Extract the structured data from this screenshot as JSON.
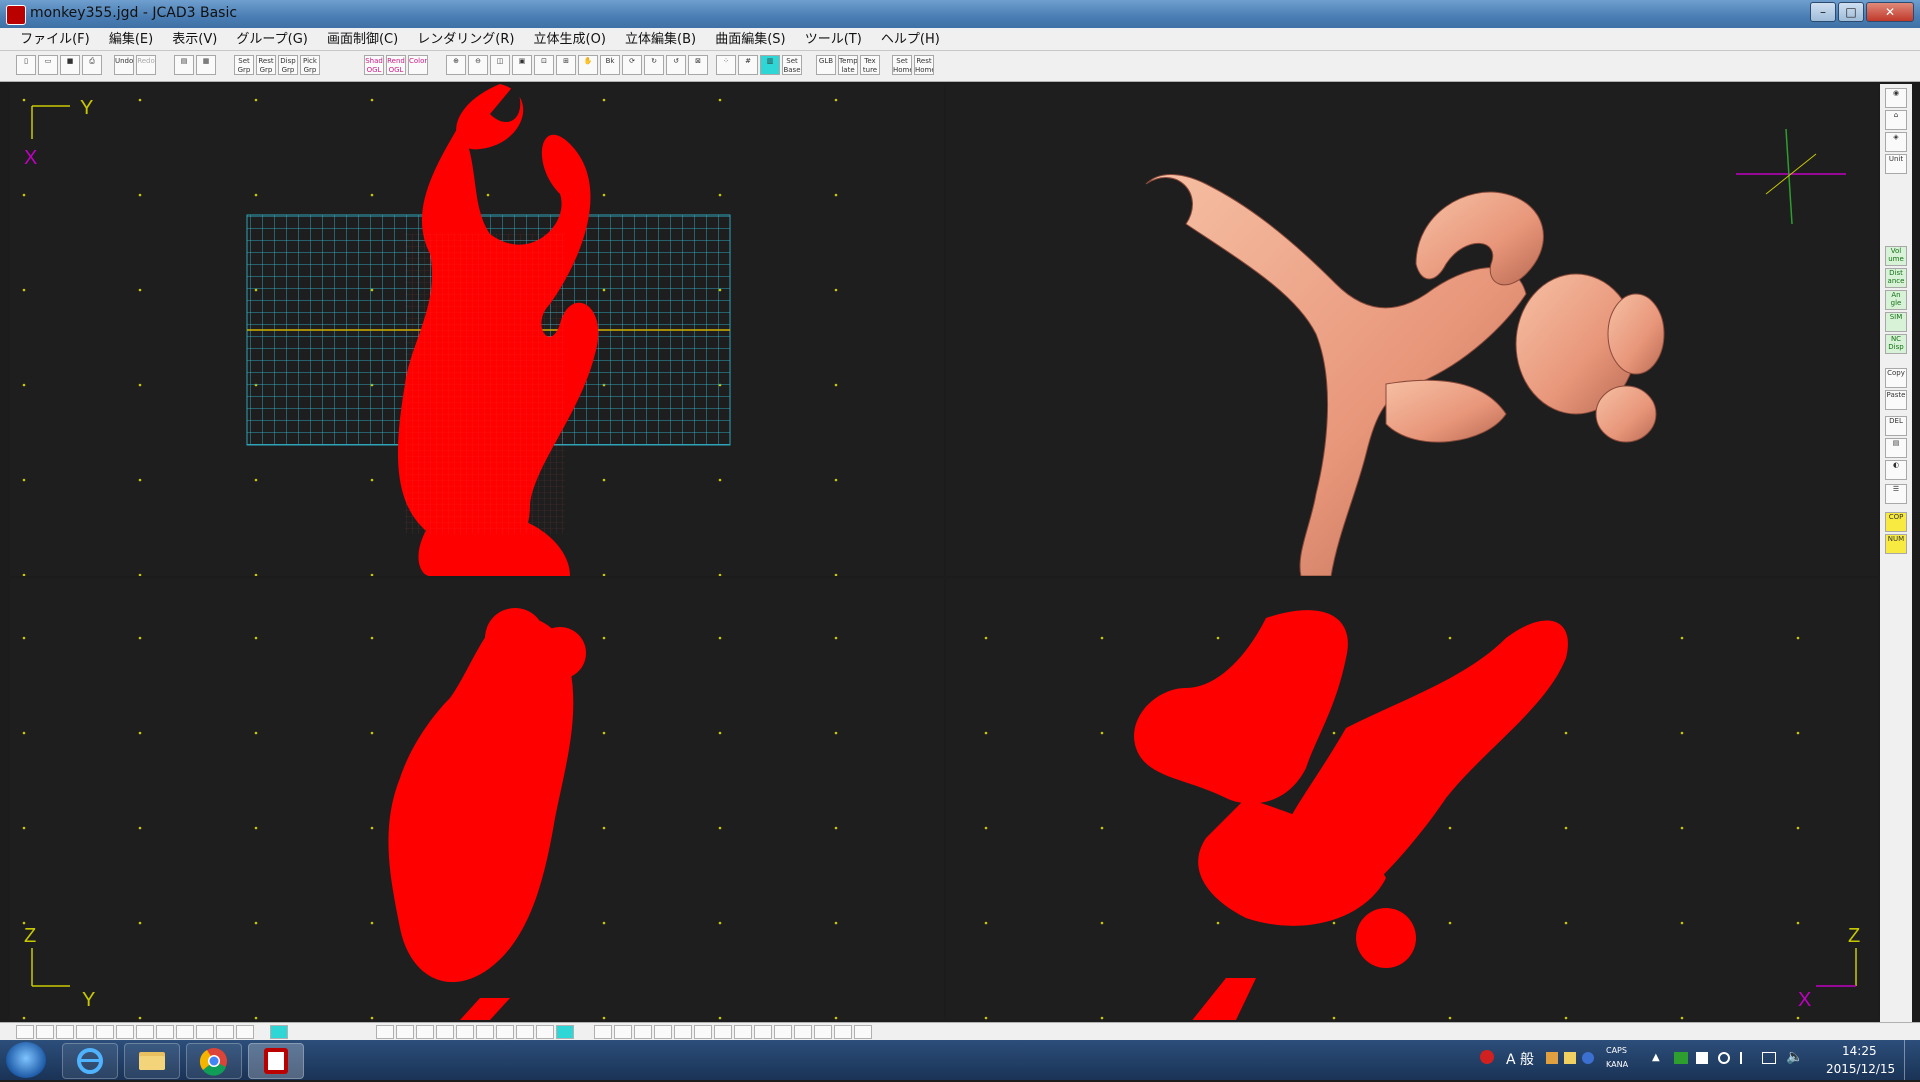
{
  "window": {
    "title": "monkey355.jgd - JCAD3 Basic"
  },
  "menu": [
    "ファイル(F)",
    "編集(E)",
    "表示(V)",
    "グループ(G)",
    "画面制御(C)",
    "レンダリング(R)",
    "立体生成(O)",
    "立体編集(B)",
    "曲面編集(S)",
    "ツール(T)",
    "ヘルプ(H)"
  ],
  "toolbar": {
    "undo": "Undo",
    "redo": "Redo",
    "set_grp": "Set Grp",
    "rest_grp": "Rest Grp",
    "disp_grp": "Disp Grp",
    "pick_grp": "Pick Grp",
    "shad_ogl": "Shad OGL",
    "rend_ogl": "Rend OGL",
    "color": "Color",
    "bk": "Bk",
    "set_base": "Set Base",
    "glb": "GLB",
    "template": "Temp late",
    "texture": "Tex ture",
    "set_home": "Set Home",
    "rest_home": "Rest Home"
  },
  "sidebar": {
    "unit": "Unit",
    "volume": "Vol ume",
    "distance": "Dist ance",
    "angle": "An gle",
    "sim": "SIM",
    "nc_disp": "NC Disp",
    "copy": "Copy",
    "paste": "Paste",
    "del": "DEL",
    "cop": "COP",
    "num": "NUM"
  },
  "viewports": {
    "top_left": {
      "axis_v": "X",
      "axis_h": "Y"
    },
    "bottom_left": {
      "axis_v": "Z",
      "axis_h": "Y"
    },
    "bottom_right": {
      "axis_v": "Z",
      "axis_h": "X"
    }
  },
  "colors": {
    "wire": "#ff0000",
    "shaded": "#e89a7a",
    "grid": "#2fa3b8",
    "axis_label": "#c8c800",
    "axis_pink": "#c000c0"
  },
  "tray": {
    "ime": "A 般",
    "caps": "CAPS",
    "kana": "KANA",
    "time": "14:25",
    "date": "2015/12/15"
  }
}
